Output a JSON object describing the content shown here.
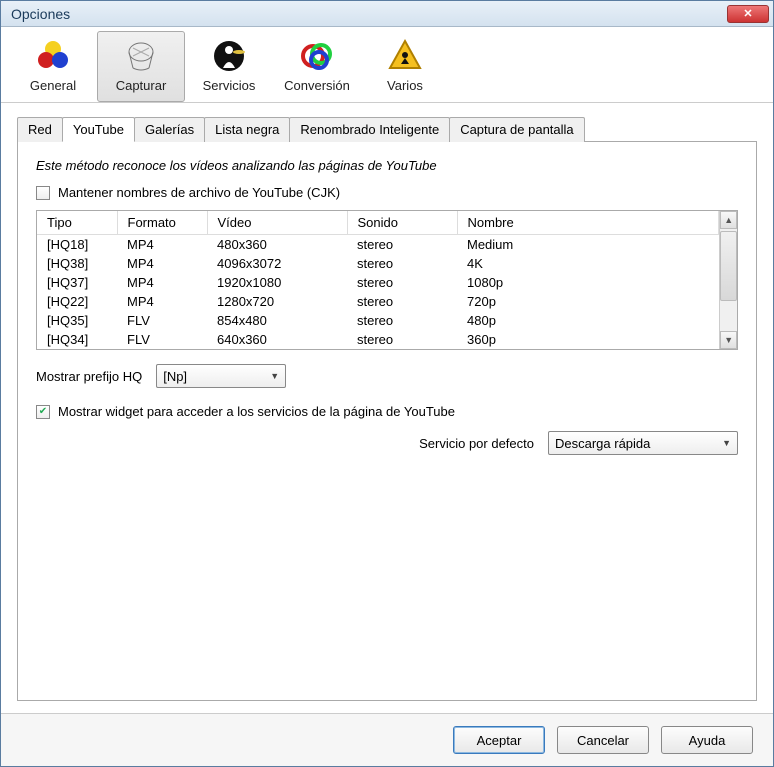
{
  "window": {
    "title": "Opciones"
  },
  "toolbar": {
    "items": [
      {
        "label": "General"
      },
      {
        "label": "Capturar"
      },
      {
        "label": "Servicios"
      },
      {
        "label": "Conversión"
      },
      {
        "label": "Varios"
      }
    ],
    "active": 1
  },
  "tabs": {
    "items": [
      {
        "label": "Red"
      },
      {
        "label": "YouTube"
      },
      {
        "label": "Galerías"
      },
      {
        "label": "Lista negra"
      },
      {
        "label": "Renombrado Inteligente"
      },
      {
        "label": "Captura de pantalla"
      }
    ],
    "active": 1
  },
  "youtube": {
    "description": "Este método reconoce los vídeos analizando las páginas de YouTube",
    "keep_names_label": "Mantener nombres de archivo de YouTube (CJK)",
    "keep_names_checked": false,
    "columns": [
      "Tipo",
      "Formato",
      "Vídeo",
      "Sonido",
      "Nombre"
    ],
    "rows": [
      {
        "tipo": "[HQ18]",
        "formato": "MP4",
        "video": "480x360",
        "sonido": "stereo",
        "nombre": "Medium"
      },
      {
        "tipo": "[HQ38]",
        "formato": "MP4",
        "video": "4096x3072",
        "sonido": "stereo",
        "nombre": "4K"
      },
      {
        "tipo": "[HQ37]",
        "formato": "MP4",
        "video": "1920x1080",
        "sonido": "stereo",
        "nombre": "1080p"
      },
      {
        "tipo": "[HQ22]",
        "formato": "MP4",
        "video": "1280x720",
        "sonido": "stereo",
        "nombre": "720p"
      },
      {
        "tipo": "[HQ35]",
        "formato": "FLV",
        "video": "854x480",
        "sonido": "stereo",
        "nombre": "480p"
      },
      {
        "tipo": "[HQ34]",
        "formato": "FLV",
        "video": "640x360",
        "sonido": "stereo",
        "nombre": "360p"
      }
    ],
    "prefix_label": "Mostrar prefijo HQ",
    "prefix_value": "[Np]",
    "widget_label": "Mostrar widget para acceder a los servicios de la página de YouTube",
    "widget_checked": true,
    "default_service_label": "Servicio por defecto",
    "default_service_value": "Descarga rápida"
  },
  "buttons": {
    "accept": "Aceptar",
    "cancel": "Cancelar",
    "help": "Ayuda"
  }
}
